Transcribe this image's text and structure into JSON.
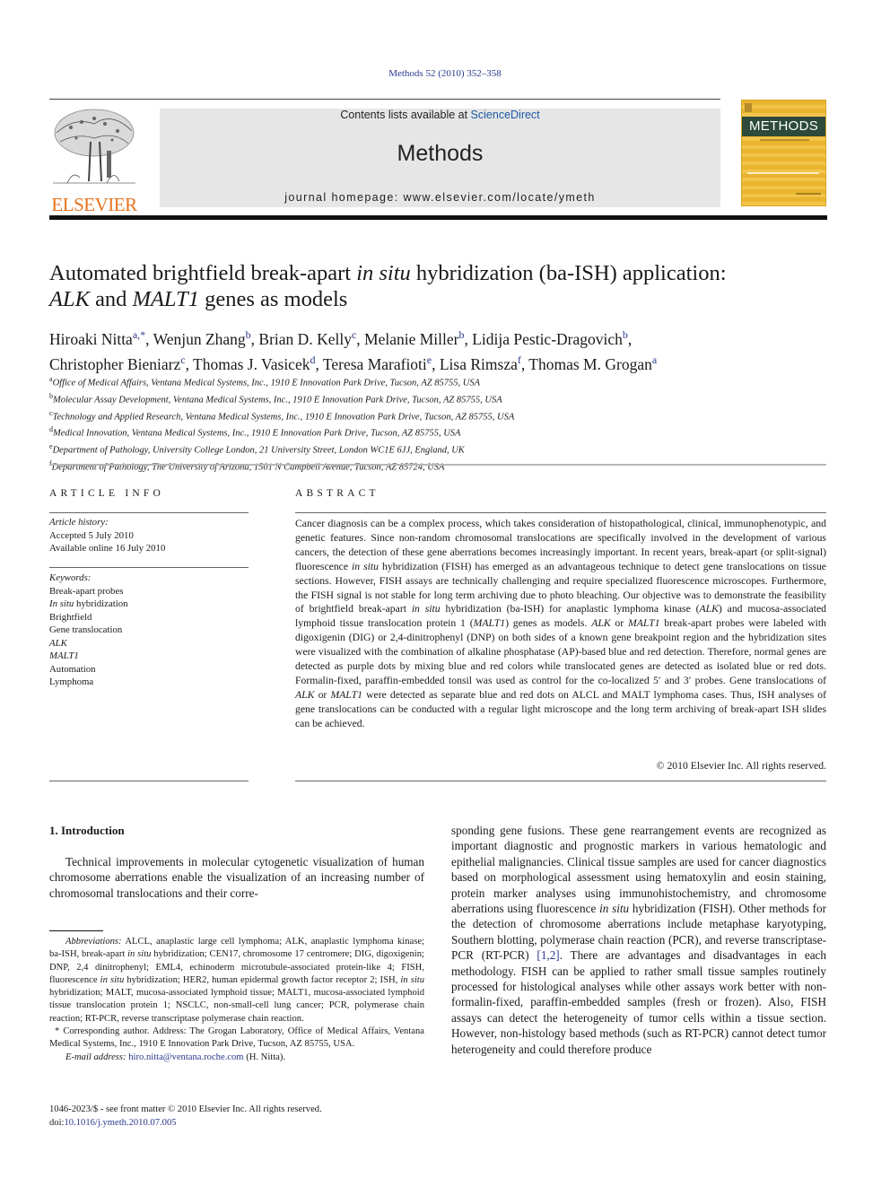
{
  "header": {
    "citation": "Methods 52 (2010) 352–358",
    "contents_prefix": "Contents lists available at ",
    "contents_link": "ScienceDirect",
    "journal_name": "Methods",
    "homepage": "journal homepage: www.elsevier.com/locate/ymeth",
    "publisher_logo_text": "ELSEVIER",
    "cover_title": "METHODS",
    "colors": {
      "link": "#2a3a8c",
      "elsevier_orange": "#e8731e",
      "cover_yellow": "#f2c44a",
      "cover_band": "#2d4a3a",
      "banner_gray": "#e6e6e6"
    }
  },
  "article": {
    "title_line1_a": "Automated brightfield break-apart ",
    "title_line1_italic": "in situ",
    "title_line1_b": " hybridization (ba-ISH) application:",
    "title_line2_italic1": "ALK",
    "title_line2_mid": " and ",
    "title_line2_italic2": "MALT1",
    "title_line2_end": " genes as models",
    "authors": [
      {
        "name": "Hiroaki Nitta",
        "sup": "a,*",
        "sep": ", "
      },
      {
        "name": "Wenjun Zhang",
        "sup": "b",
        "sep": ", "
      },
      {
        "name": "Brian D. Kelly",
        "sup": "c",
        "sep": ", "
      },
      {
        "name": "Melanie Miller",
        "sup": "b",
        "sep": ", "
      },
      {
        "name": "Lidija Pestic-Dragovich",
        "sup": "b",
        "sep": ","
      },
      {
        "name": "Christopher Bieniarz",
        "sup": "c",
        "sep": ", "
      },
      {
        "name": "Thomas J. Vasicek",
        "sup": "d",
        "sep": ", "
      },
      {
        "name": "Teresa Marafioti",
        "sup": "e",
        "sep": ", "
      },
      {
        "name": "Lisa Rimsza",
        "sup": "f",
        "sep": ", "
      },
      {
        "name": "Thomas M. Grogan",
        "sup": "a",
        "sep": ""
      }
    ],
    "affiliations": [
      {
        "key": "a",
        "text": "Office of Medical Affairs, Ventana Medical Systems, Inc., 1910 E Innovation Park Drive, Tucson, AZ 85755, USA"
      },
      {
        "key": "b",
        "text": "Molecular Assay Development, Ventana Medical Systems, Inc., 1910 E Innovation Park Drive, Tucson, AZ 85755, USA"
      },
      {
        "key": "c",
        "text": "Technology and Applied Research, Ventana Medical Systems, Inc., 1910 E Innovation Park Drive, Tucson, AZ 85755, USA"
      },
      {
        "key": "d",
        "text": "Medical Innovation, Ventana Medical Systems, Inc., 1910 E Innovation Park Drive, Tucson, AZ 85755, USA"
      },
      {
        "key": "e",
        "text": "Department of Pathology, University College London, 21 University Street, London WC1E 6JJ, England, UK"
      },
      {
        "key": "f",
        "text": "Department of Pathology, The University of Arizona, 1501 N Campbell Avenue, Tucson, AZ 85724, USA"
      }
    ]
  },
  "article_info": {
    "heading": "ARTICLE INFO",
    "history_label": "Article history:",
    "accepted": "Accepted 5 July 2010",
    "online": "Available online 16 July 2010",
    "keywords_label": "Keywords:",
    "keywords": [
      {
        "text": "Break-apart probes",
        "italic_prefix": ""
      },
      {
        "text": " hybridization",
        "italic_prefix": "In situ"
      },
      {
        "text": "Brightfield",
        "italic_prefix": ""
      },
      {
        "text": "Gene translocation",
        "italic_prefix": ""
      },
      {
        "text": "",
        "italic_prefix": "ALK"
      },
      {
        "text": "",
        "italic_prefix": "MALT1"
      },
      {
        "text": "Automation",
        "italic_prefix": ""
      },
      {
        "text": "Lymphoma",
        "italic_prefix": ""
      }
    ]
  },
  "abstract": {
    "heading": "ABSTRACT",
    "p1": "Cancer diagnosis can be a complex process, which takes consideration of histopathological, clinical, immunophenotypic, and genetic features. Since non-random chromosomal translocations are specifically involved in the development of various cancers, the detection of these gene aberrations becomes increasingly important. In recent years, break-apart (or split-signal) fluorescence ",
    "i1": "in situ",
    "p2": " hybridization (FISH) has emerged as an advantageous technique to detect gene translocations on tissue sections. However, FISH assays are technically challenging and require specialized fluorescence microscopes. Furthermore, the FISH signal is not stable for long term archiving due to photo bleaching. Our objective was to demonstrate the feasibility of brightfield break-apart ",
    "i2": "in situ",
    "p3": " hybridization (ba-ISH) for anaplastic lymphoma kinase (",
    "i3": "ALK",
    "p4": ") and mucosa-associated lymphoid tissue translocation protein 1 (",
    "i4": "MALT1",
    "p5": ") genes as models. ",
    "i5": "ALK",
    "p6": " or ",
    "i6": "MALT1",
    "p7": " break-apart probes were labeled with digoxigenin (DIG) or 2,4-dinitrophenyl (DNP) on both sides of a known gene breakpoint region and the hybridization sites were visualized with the combination of alkaline phosphatase (AP)-based blue and red detection. Therefore, normal genes are detected as purple dots by mixing blue and red colors while translocated genes are detected as isolated blue or red dots. Formalin-fixed, paraffin-embedded tonsil was used as control for the co-localized 5′ and 3′ probes. Gene translocations of ",
    "i7": "ALK",
    "p8": " or ",
    "i8": "MALT1",
    "p9": " were detected as separate blue and red dots on ALCL and MALT lymphoma cases. Thus, ISH analyses of gene translocations can be conducted with a regular light microscope and the long term archiving of break-apart ISH slides can be achieved.",
    "copyright": "© 2010 Elsevier Inc. All rights reserved."
  },
  "intro": {
    "heading": "1. Introduction",
    "p1": "Technical improvements in molecular cytogenetic visualization of human chromosome aberrations enable the visualization of an increasing number of chromosomal translocations and their corre-",
    "col2_a": "sponding gene fusions. These gene rearrangement events are recognized as important diagnostic and prognostic markers in various hematologic and epithelial malignancies. Clinical tissue samples are used for cancer diagnostics based on morphological assessment using hematoxylin and eosin staining, protein marker analyses using immunohistochemistry, and chromosome aberrations using fluorescence ",
    "col2_i": "in situ",
    "col2_b": " hybridization (FISH). Other methods for the detection of chromosome aberrations include metaphase karyotyping, Southern blotting, polymerase chain reaction (PCR), and reverse transcriptase-PCR (RT-PCR) ",
    "col2_ref": "[1,2]",
    "col2_c": ". There are advantages and disadvantages in each methodology. FISH can be applied to rather small tissue samples routinely processed for histological analyses while other assays work better with non-formalin-fixed, paraffin-embedded samples (fresh or frozen). Also, FISH assays can detect the heterogeneity of tumor cells within a tissue section. However, non-histology based methods (such as RT-PCR) cannot detect tumor heterogeneity and could therefore produce"
  },
  "footnotes": {
    "abbr_label": "Abbreviations:",
    "abbr_a": " ALCL, anaplastic large cell lymphoma; ALK, anaplastic lymphoma kinase; ba-ISH, break-apart ",
    "abbr_i1": "in situ",
    "abbr_b": " hybridization; CEN17, chromosome 17 centromere; DIG, digoxigenin; DNP, 2,4 dinitrophenyl; EML4, echinoderm microtubule-associated protein-like 4; FISH, fluorescence ",
    "abbr_i2": "in situ",
    "abbr_c": " hybridization; HER2, human epidermal growth factor receptor 2; ISH, ",
    "abbr_i3": "in situ",
    "abbr_d": " hybridization; MALT, mucosa-associated lymphoid tissue; MALT1, mucosa-associated lymphoid tissue translocation protein 1; NSCLC, non-small-cell lung cancer; PCR, polymerase chain reaction; RT-PCR, reverse transcriptase polymerase chain reaction.",
    "corresponding": "* Corresponding author. Address: The Grogan Laboratory, Office of Medical Affairs, Ventana Medical Systems, Inc., 1910 E Innovation Park Drive, Tucson, AZ 85755, USA.",
    "email_label": "E-mail address:",
    "email": "hiro.nitta@ventana.roche.com",
    "email_suffix": " (H. Nitta)."
  },
  "front_matter": {
    "issn_line": "1046-2023/$ - see front matter © 2010 Elsevier Inc. All rights reserved.",
    "doi_prefix": "doi:",
    "doi": "10.1016/j.ymeth.2010.07.005"
  }
}
